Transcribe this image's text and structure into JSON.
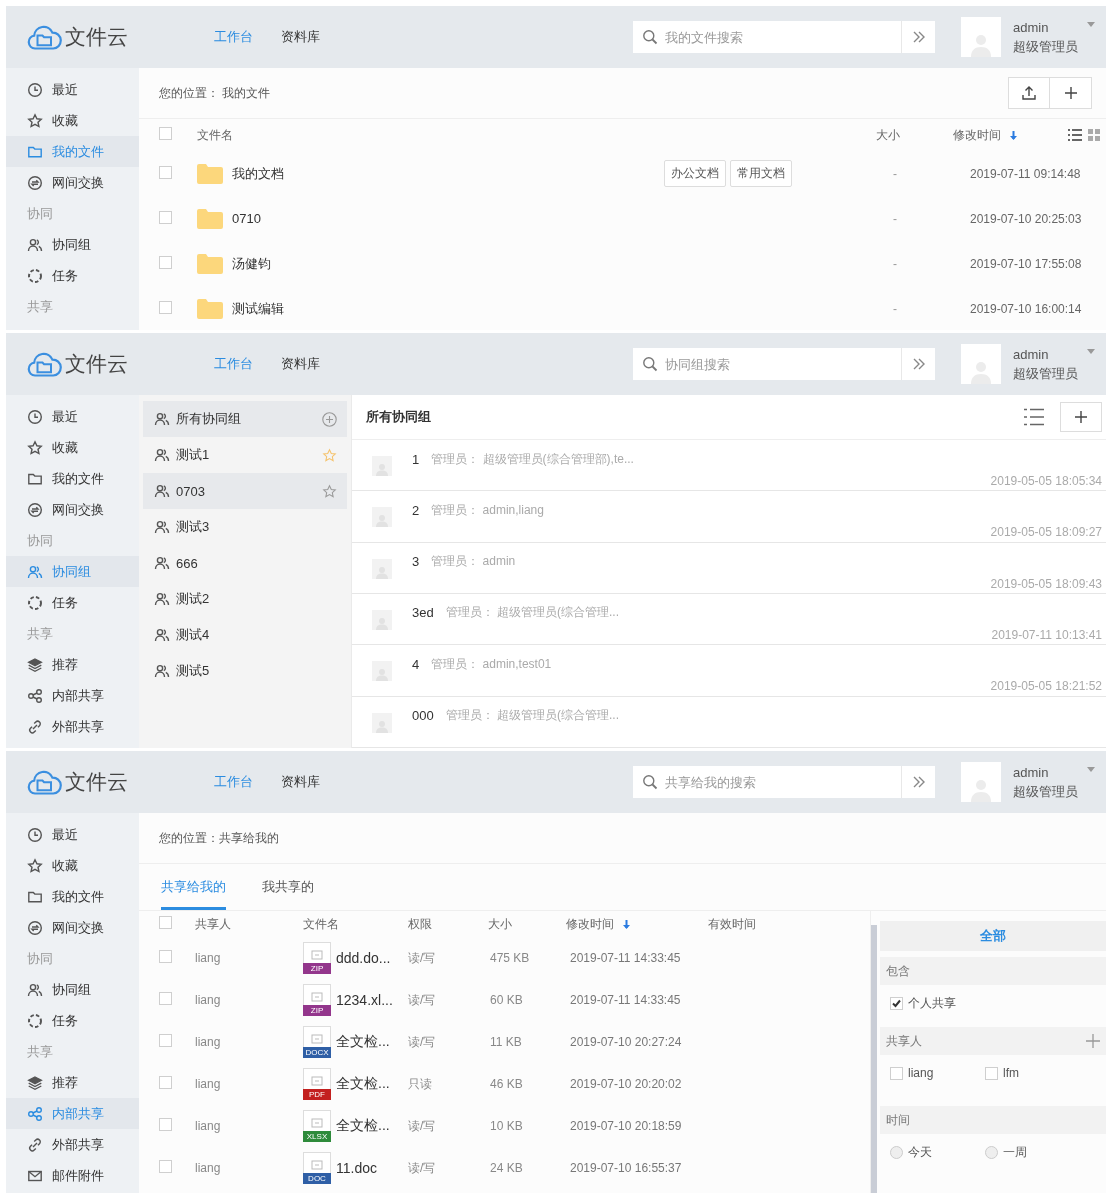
{
  "screens": [
    {
      "kind": "files",
      "header": {
        "logo": "文件云",
        "nav": [
          {
            "label": "工作台",
            "selected": true
          },
          {
            "label": "资料库",
            "selected": false
          }
        ],
        "search": {
          "placeholder": "我的文件搜索"
        },
        "user": {
          "name": "admin",
          "role": "超级管理员"
        }
      },
      "sidebar": [
        {
          "kind": "item",
          "label": "最近",
          "selected": false
        },
        {
          "kind": "item",
          "label": "收藏",
          "selected": false
        },
        {
          "kind": "item",
          "label": "我的文件",
          "selected": true
        },
        {
          "kind": "item",
          "label": "网间交换",
          "selected": false
        },
        {
          "kind": "section",
          "label": "协同"
        },
        {
          "kind": "item",
          "label": "协同组",
          "selected": false
        },
        {
          "kind": "item",
          "label": "任务",
          "selected": false
        },
        {
          "kind": "section",
          "label": "共享"
        }
      ],
      "breadcrumb": "您的位置： 我的文件",
      "all_checked": false,
      "columns": [
        {
          "label": "文件名",
          "sorted": false
        },
        {
          "label": "大小",
          "sorted": false
        },
        {
          "label": "修改时间",
          "sorted": true
        }
      ],
      "rows": [
        {
          "name": "我的文档",
          "tags": [
            "办公文档",
            "常用文档"
          ],
          "size": "-",
          "modified": "2019-07-11 09:14:48",
          "checked": false
        },
        {
          "name": "0710",
          "tags": [],
          "size": "-",
          "modified": "2019-07-10 20:25:03",
          "checked": false
        },
        {
          "name": "汤健钧",
          "tags": [],
          "size": "-",
          "modified": "2019-07-10 17:55:08",
          "checked": false
        },
        {
          "name": "测试编辑",
          "tags": [],
          "size": "-",
          "modified": "2019-07-10 16:00:14",
          "checked": false
        }
      ]
    },
    {
      "kind": "groups",
      "header": {
        "logo": "文件云",
        "nav": [
          {
            "label": "工作台",
            "selected": true
          },
          {
            "label": "资料库",
            "selected": false
          }
        ],
        "search": {
          "placeholder": "协同组搜索"
        },
        "user": {
          "name": "admin",
          "role": "超级管理员"
        }
      },
      "sidebar": [
        {
          "kind": "item",
          "label": "最近",
          "selected": false
        },
        {
          "kind": "item",
          "label": "收藏",
          "selected": false
        },
        {
          "kind": "item",
          "label": "我的文件",
          "selected": false
        },
        {
          "kind": "item",
          "label": "网间交换",
          "selected": false
        },
        {
          "kind": "section",
          "label": "协同"
        },
        {
          "kind": "item",
          "label": "协同组",
          "selected": true
        },
        {
          "kind": "item",
          "label": "任务",
          "selected": false
        },
        {
          "kind": "section",
          "label": "共享"
        },
        {
          "kind": "item",
          "label": "推荐",
          "selected": false
        },
        {
          "kind": "item",
          "label": "内部共享",
          "selected": false
        },
        {
          "kind": "item",
          "label": "外部共享",
          "selected": false
        }
      ],
      "group_list": [
        {
          "kind": "all",
          "label": "所有协同组",
          "selected": true
        },
        {
          "kind": "group",
          "label": "测试1",
          "selected": false,
          "starred": true
        },
        {
          "kind": "group",
          "label": "0703",
          "selected": true,
          "starred": false
        },
        {
          "kind": "group",
          "label": "测试3",
          "selected": false,
          "starred": false
        },
        {
          "kind": "group",
          "label": "666",
          "selected": false,
          "starred": false
        },
        {
          "kind": "group",
          "label": "测试2",
          "selected": false,
          "starred": false
        },
        {
          "kind": "group",
          "label": "测试4",
          "selected": false,
          "starred": false
        },
        {
          "kind": "group",
          "label": "测试5",
          "selected": false,
          "starred": false
        }
      ],
      "title": "所有协同组",
      "rows": [
        {
          "name": "1",
          "admins": "管理员： 超级管理员(综合管理部),te...",
          "time": "2019-05-05 18:05:34"
        },
        {
          "name": "2",
          "admins": "管理员： admin,liang",
          "time": "2019-05-05 18:09:27"
        },
        {
          "name": "3",
          "admins": "管理员： admin",
          "time": "2019-05-05 18:09:43"
        },
        {
          "name": "3ed",
          "admins": "管理员： 超级管理员(综合管理...",
          "time": "2019-07-11 10:13:41"
        },
        {
          "name": "4",
          "admins": "管理员： admin,test01",
          "time": "2019-05-05 18:21:52"
        },
        {
          "name": "000",
          "admins": "管理员： 超级管理员(综合管理..."
        }
      ]
    },
    {
      "kind": "shares",
      "header": {
        "logo": "文件云",
        "nav": [
          {
            "label": "工作台",
            "selected": true
          },
          {
            "label": "资料库",
            "selected": false
          }
        ],
        "search": {
          "placeholder": "共享给我的搜索"
        },
        "user": {
          "name": "admin",
          "role": "超级管理员"
        }
      },
      "sidebar": [
        {
          "kind": "item",
          "label": "最近",
          "selected": false
        },
        {
          "kind": "item",
          "label": "收藏",
          "selected": false
        },
        {
          "kind": "item",
          "label": "我的文件",
          "selected": false
        },
        {
          "kind": "item",
          "label": "网间交换",
          "selected": false
        },
        {
          "kind": "section",
          "label": "协同"
        },
        {
          "kind": "item",
          "label": "协同组",
          "selected": false
        },
        {
          "kind": "item",
          "label": "任务",
          "selected": false
        },
        {
          "kind": "section",
          "label": "共享"
        },
        {
          "kind": "item",
          "label": "推荐",
          "selected": false
        },
        {
          "kind": "item",
          "label": "内部共享",
          "selected": true
        },
        {
          "kind": "item",
          "label": "外部共享",
          "selected": false
        },
        {
          "kind": "item",
          "label": "邮件附件",
          "selected": false
        }
      ],
      "breadcrumb": "您的位置：共享给我的",
      "tabs": [
        {
          "label": "共享给我的",
          "selected": true
        },
        {
          "label": "我共享的",
          "selected": false
        }
      ],
      "all_checked": false,
      "columns": [
        {
          "label": "共享人",
          "sorted": false
        },
        {
          "label": "文件名",
          "sorted": false
        },
        {
          "label": "权限",
          "sorted": false
        },
        {
          "label": "大小",
          "sorted": false
        },
        {
          "label": "修改时间",
          "sorted": true
        },
        {
          "label": "有效时间",
          "sorted": false
        }
      ],
      "rows": [
        {
          "sharer": "liang",
          "type": "ZIP",
          "color": "#93368c",
          "name": "ddd.do...",
          "permission": "读/写",
          "size": "475 KB",
          "modified": "2019-07-11 14:33:45",
          "checked": false
        },
        {
          "sharer": "liang",
          "type": "ZIP",
          "color": "#93368c",
          "name": "1234.xl...",
          "permission": "读/写",
          "size": "60 KB",
          "modified": "2019-07-11 14:33:45",
          "checked": false
        },
        {
          "sharer": "liang",
          "type": "DOCX",
          "color": "#2f5fa6",
          "name": "全文检...",
          "permission": "读/写",
          "size": "11 KB",
          "modified": "2019-07-10 20:27:24",
          "checked": false
        },
        {
          "sharer": "liang",
          "type": "PDF",
          "color": "#c3201f",
          "name": "全文检...",
          "permission": "只读",
          "size": "46 KB",
          "modified": "2019-07-10 20:20:02",
          "checked": false
        },
        {
          "sharer": "liang",
          "type": "XLSX",
          "color": "#2e8b3b",
          "name": "全文检...",
          "permission": "读/写",
          "size": "10 KB",
          "modified": "2019-07-10 20:18:59",
          "checked": false
        },
        {
          "sharer": "liang",
          "type": "DOC",
          "color": "#2f5fa6",
          "name": "11.doc",
          "permission": "读/写",
          "size": "24 KB",
          "modified": "2019-07-10 16:55:37",
          "checked": false
        }
      ],
      "filter": {
        "all": "全部",
        "sections": [
          {
            "kind": "checkboxes",
            "title": "包含",
            "addable": false,
            "options": [
              {
                "label": "个人共享",
                "checked": true
              }
            ]
          },
          {
            "kind": "checkboxes",
            "title": "共享人",
            "addable": true,
            "options": [
              {
                "label": "liang",
                "checked": false
              },
              {
                "label": "lfm",
                "checked": false
              }
            ]
          },
          {
            "kind": "radios",
            "title": "时间",
            "addable": false,
            "options": [
              {
                "label": "今天",
                "selected": false
              },
              {
                "label": "一周",
                "selected": false
              }
            ]
          }
        ]
      }
    }
  ]
}
